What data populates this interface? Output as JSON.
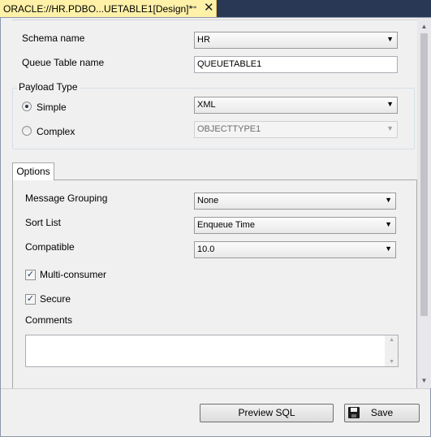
{
  "document_tab": {
    "title": "ORACLE://HR.PDBO...UETABLE1[Design]*",
    "pin_glyph": "⊸",
    "close_glyph": "✕"
  },
  "form": {
    "schema_label": "Schema name",
    "schema_value": "HR",
    "queue_table_label": "Queue Table name",
    "queue_table_value": "QUEUETABLE1",
    "payload_group_label": "Payload Type",
    "simple_label": "Simple",
    "simple_value": "XML",
    "simple_checked": true,
    "complex_label": "Complex",
    "complex_value": "OBJECTTYPE1",
    "complex_checked": false
  },
  "options_tab": {
    "label": "Options",
    "message_grouping_label": "Message Grouping",
    "message_grouping_value": "None",
    "sort_list_label": "Sort List",
    "sort_list_value": "Enqueue Time",
    "compatible_label": "Compatible",
    "compatible_value": "10.0",
    "multi_consumer_label": "Multi-consumer",
    "multi_consumer_checked": true,
    "secure_label": "Secure",
    "secure_checked": true,
    "comments_label": "Comments",
    "comments_value": ""
  },
  "buttons": {
    "preview_sql": "Preview SQL",
    "save": "Save"
  },
  "icons": {
    "dropdown": "▼",
    "check": "✓",
    "scroll_up": "▲",
    "scroll_down": "▼"
  },
  "colors": {
    "ide_frame": "#293955",
    "active_tab": "#fff1a8",
    "panel_bg": "#f0f0f0"
  }
}
